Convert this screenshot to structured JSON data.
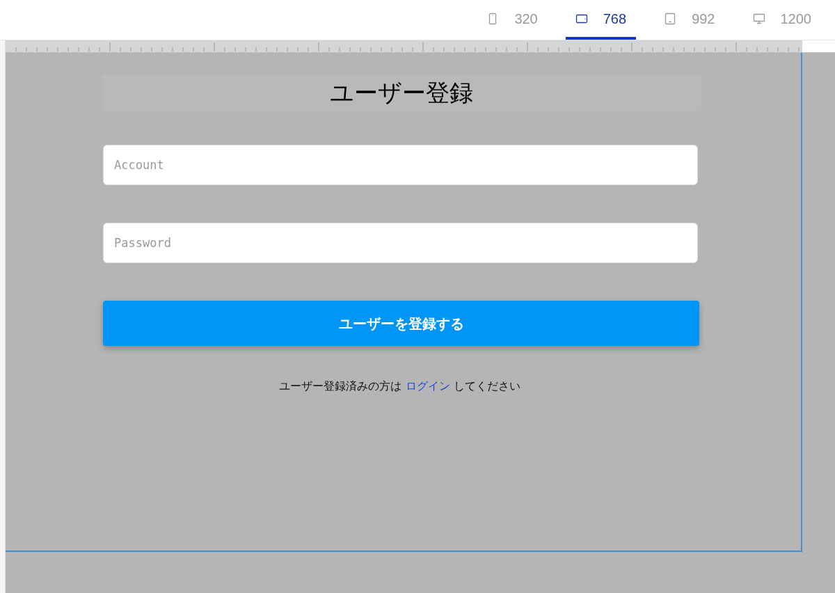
{
  "viewport_tabs": [
    {
      "kind": "phone",
      "label": "320",
      "selected": false
    },
    {
      "kind": "tablet-landscape",
      "label": "768",
      "selected": true
    },
    {
      "kind": "tablet",
      "label": "992",
      "selected": false
    },
    {
      "kind": "desktop",
      "label": "1200",
      "selected": false
    }
  ],
  "page": {
    "title": "ユーザー登録",
    "fields": [
      {
        "placeholder": "Account"
      },
      {
        "placeholder": "Password"
      }
    ],
    "submit_button": "ユーザーを登録する",
    "footer": {
      "before": "ユーザー登録済みの方は",
      "link": "ログイン",
      "after": "してください"
    }
  }
}
